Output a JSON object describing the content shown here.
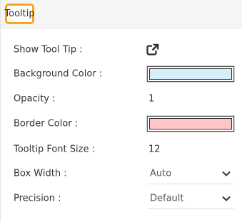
{
  "section": {
    "title": "Tooltip"
  },
  "rows": {
    "show_tooltip": {
      "label": "Show Tool Tip :",
      "icon": "external-link-icon"
    },
    "background_color": {
      "label": "Background Color :",
      "color": "#d6eef8"
    },
    "opacity": {
      "label": "Opacity :",
      "value": "1"
    },
    "border_color": {
      "label": "Border Color :",
      "color": "#ffc6c6"
    },
    "tooltip_font_size": {
      "label": "Tooltip Font Size :",
      "value": "12"
    },
    "box_width": {
      "label": "Box Width :",
      "value": "Auto"
    },
    "precision": {
      "label": "Precision :",
      "value": "Default"
    }
  },
  "colors": {
    "accent_highlight": "#f5a623"
  }
}
